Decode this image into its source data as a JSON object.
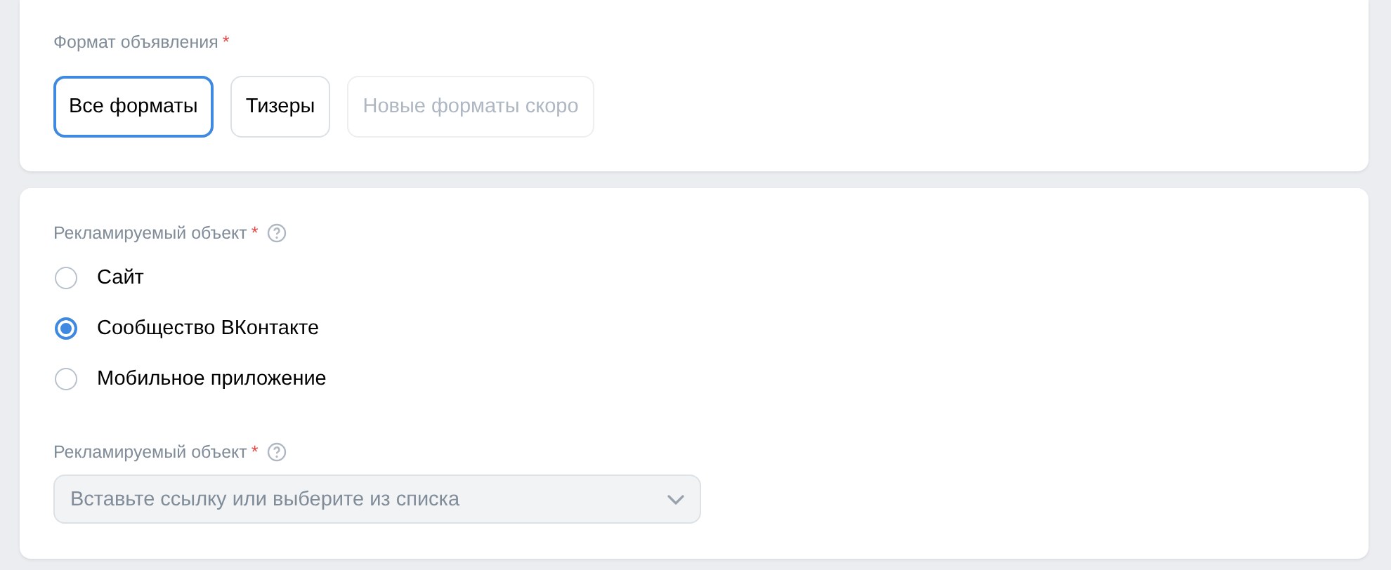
{
  "format_section": {
    "label": "Формат объявления",
    "required_mark": "*",
    "options": [
      {
        "label": "Все форматы",
        "selected": true,
        "disabled": false
      },
      {
        "label": "Тизеры",
        "selected": false,
        "disabled": false
      },
      {
        "label": "Новые форматы скоро",
        "selected": false,
        "disabled": true
      }
    ]
  },
  "object_section": {
    "label": "Рекламируемый объект",
    "required_mark": "*",
    "help": true,
    "radios": [
      {
        "label": "Сайт",
        "selected": false
      },
      {
        "label": "Сообщество ВКонтакте",
        "selected": true
      },
      {
        "label": "Мобильное приложение",
        "selected": false
      }
    ],
    "select": {
      "label": "Рекламируемый объект",
      "required_mark": "*",
      "help": true,
      "placeholder": "Вставьте ссылку или выберите из списка"
    }
  }
}
